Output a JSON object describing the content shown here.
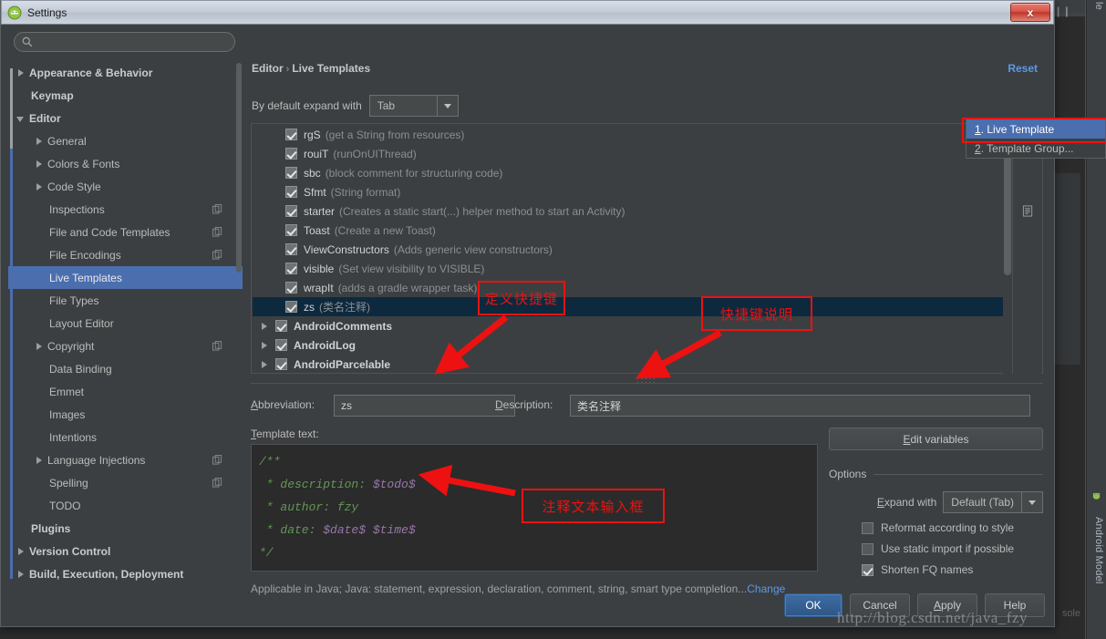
{
  "window": {
    "title": "Settings",
    "app_icon": "android-studio-icon",
    "close_label": "x"
  },
  "sidebar": {
    "search": {
      "placeholder": "",
      "value": "",
      "icon": "search-icon"
    },
    "items": [
      {
        "label": "Appearance & Behavior",
        "arrow": "collapsed",
        "bold": true,
        "indent": 8,
        "copy": false
      },
      {
        "label": "Keymap",
        "arrow": "none",
        "bold": true,
        "indent": 25,
        "copy": false
      },
      {
        "label": "Editor",
        "arrow": "expanded",
        "bold": true,
        "indent": 8,
        "copy": false
      },
      {
        "label": "General",
        "arrow": "collapsed",
        "bold": false,
        "indent": 28,
        "copy": false
      },
      {
        "label": "Colors & Fonts",
        "arrow": "collapsed",
        "bold": false,
        "indent": 28,
        "copy": false
      },
      {
        "label": "Code Style",
        "arrow": "collapsed",
        "bold": false,
        "indent": 28,
        "copy": false
      },
      {
        "label": "Inspections",
        "arrow": "none",
        "bold": false,
        "indent": 45,
        "copy": true
      },
      {
        "label": "File and Code Templates",
        "arrow": "none",
        "bold": false,
        "indent": 45,
        "copy": true
      },
      {
        "label": "File Encodings",
        "arrow": "none",
        "bold": false,
        "indent": 45,
        "copy": true
      },
      {
        "label": "Live Templates",
        "arrow": "none",
        "bold": false,
        "indent": 45,
        "copy": false,
        "selected": true
      },
      {
        "label": "File Types",
        "arrow": "none",
        "bold": false,
        "indent": 45,
        "copy": false
      },
      {
        "label": "Layout Editor",
        "arrow": "none",
        "bold": false,
        "indent": 45,
        "copy": false
      },
      {
        "label": "Copyright",
        "arrow": "collapsed",
        "bold": false,
        "indent": 28,
        "copy": true
      },
      {
        "label": "Data Binding",
        "arrow": "none",
        "bold": false,
        "indent": 45,
        "copy": false
      },
      {
        "label": "Emmet",
        "arrow": "none",
        "bold": false,
        "indent": 45,
        "copy": false
      },
      {
        "label": "Images",
        "arrow": "none",
        "bold": false,
        "indent": 45,
        "copy": false
      },
      {
        "label": "Intentions",
        "arrow": "none",
        "bold": false,
        "indent": 45,
        "copy": false
      },
      {
        "label": "Language Injections",
        "arrow": "collapsed",
        "bold": false,
        "indent": 28,
        "copy": true
      },
      {
        "label": "Spelling",
        "arrow": "none",
        "bold": false,
        "indent": 45,
        "copy": true
      },
      {
        "label": "TODO",
        "arrow": "none",
        "bold": false,
        "indent": 45,
        "copy": false
      },
      {
        "label": "Plugins",
        "arrow": "none",
        "bold": true,
        "indent": 25,
        "copy": false
      },
      {
        "label": "Version Control",
        "arrow": "collapsed",
        "bold": true,
        "indent": 8,
        "copy": false
      },
      {
        "label": "Build, Execution, Deployment",
        "arrow": "collapsed",
        "bold": true,
        "indent": 8,
        "copy": false
      }
    ]
  },
  "header": {
    "breadcrumb_root": "Editor",
    "breadcrumb_sep": "›",
    "breadcrumb_leaf": "Live Templates",
    "reset_label": "Reset",
    "expand_with_label": "By default expand with",
    "expand_with_value": "Tab"
  },
  "templates": {
    "toolbar": {
      "add_icon": "plus-icon",
      "doc_icon": "document-icon"
    },
    "rows": [
      {
        "abbr": "rgS",
        "desc": "(get a String from resources)",
        "checked": true,
        "group": false
      },
      {
        "abbr": "rouiT",
        "desc": "(runOnUIThread)",
        "checked": true,
        "group": false
      },
      {
        "abbr": "sbc",
        "desc": "(block comment for structuring code)",
        "checked": true,
        "group": false
      },
      {
        "abbr": "Sfmt",
        "desc": "(String format)",
        "checked": true,
        "group": false
      },
      {
        "abbr": "starter",
        "desc": "(Creates a static start(...) helper method to start an Activity)",
        "checked": true,
        "group": false
      },
      {
        "abbr": "Toast",
        "desc": "(Create a new Toast)",
        "checked": true,
        "group": false
      },
      {
        "abbr": "ViewConstructors",
        "desc": "(Adds generic view constructors)",
        "checked": true,
        "group": false
      },
      {
        "abbr": "visible",
        "desc": "(Set view visibility to VISIBLE)",
        "checked": true,
        "group": false
      },
      {
        "abbr": "wrapIt",
        "desc": "(adds a gradle wrapper task)",
        "checked": true,
        "group": false
      },
      {
        "abbr": "zs",
        "desc": "(类名注释)",
        "checked": true,
        "group": false,
        "selected": true
      },
      {
        "abbr": "AndroidComments",
        "desc": "",
        "checked": true,
        "group": true
      },
      {
        "abbr": "AndroidLog",
        "desc": "",
        "checked": true,
        "group": true
      },
      {
        "abbr": "AndroidParcelable",
        "desc": "",
        "checked": true,
        "group": true
      }
    ]
  },
  "detail": {
    "abbreviation_label": "Abbreviation:",
    "abbreviation_accel": "A",
    "abbreviation_value": "zs",
    "description_label": "Description:",
    "description_accel": "D",
    "description_value": "类名注释",
    "template_text_label": "Template text:",
    "template_text_accel": "T",
    "code_lines": [
      {
        "text": "/**",
        "kind": "comment"
      },
      {
        "text": " * description: ",
        "kind": "comment",
        "var": "$todo$"
      },
      {
        "text": " * author: fzy",
        "kind": "comment"
      },
      {
        "text": " * date: ",
        "kind": "comment",
        "var": "$date$ $time$"
      },
      {
        "text": "*/",
        "kind": "comment"
      }
    ],
    "applicable_text": "Applicable in Java; Java: statement, expression, declaration, comment, string, smart type completion...",
    "change_link": "Change"
  },
  "options": {
    "edit_variables_label": "Edit variables",
    "edit_variables_accel": "E",
    "title": "Options",
    "expand_with_label": "Expand with",
    "expand_with_accel": "E",
    "expand_with_value": "Default (Tab)",
    "checkboxes": [
      {
        "label": "Reformat according to style",
        "accel": "R",
        "checked": false
      },
      {
        "label": "Use static import if possible",
        "accel": "i",
        "checked": false
      },
      {
        "label": "Shorten FQ names",
        "accel": "Q",
        "checked": true
      }
    ]
  },
  "buttons": {
    "ok": "OK",
    "cancel": "Cancel",
    "apply": "Apply",
    "apply_accel": "A",
    "help": "Help"
  },
  "popup_menu": {
    "items": [
      {
        "num": "1",
        "label": ". Live Template",
        "highlighted": true
      },
      {
        "num": "2",
        "label": ". Template Group...",
        "highlighted": false
      }
    ]
  },
  "annotations": [
    {
      "id": "anno-1",
      "text": "定义快捷键"
    },
    {
      "id": "anno-2",
      "text": "快捷键说明"
    },
    {
      "id": "anno-3",
      "text": "注释文本输入框"
    }
  ],
  "ide": {
    "right_tab_top": "le",
    "right_tab_bottom": "Android Model",
    "console_ghost": "sole",
    "android_icon": "android-icon"
  },
  "watermark": "http://blog.csdn.net/java_fzy",
  "colors": {
    "accent_blue": "#4b6eaf",
    "link_blue": "#5a9ae6",
    "annotation_red": "#ee1111",
    "selection_navy": "#0d293e",
    "panel_bg": "#3c3f41",
    "editor_bg": "#2b2b2b",
    "code_green": "#629755",
    "code_purple": "#9876aa"
  }
}
